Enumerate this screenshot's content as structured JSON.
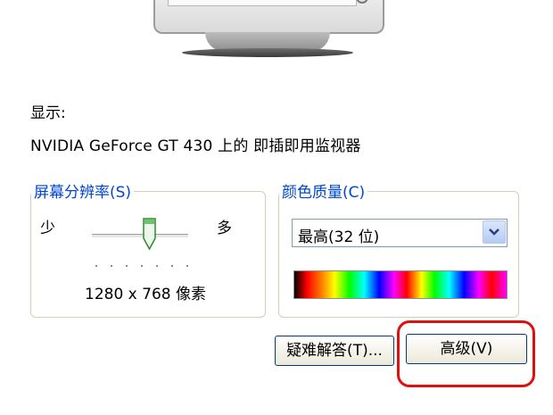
{
  "display": {
    "label": "显示:",
    "device": "NVIDIA GeForce GT 430 上的 即插即用监视器"
  },
  "resolution": {
    "title": "屏幕分辨率(S)",
    "less_label": "少",
    "more_label": "多",
    "value": "1280 x 768 像素",
    "slider_level": 0.6
  },
  "color_quality": {
    "title": "颜色质量(C)",
    "selected": "最高(32 位)"
  },
  "buttons": {
    "troubleshoot": "疑难解答(T)...",
    "advanced": "高级(V)"
  },
  "colors": {
    "group_title": "#0046d5",
    "highlight": "#e01010"
  },
  "icons": {
    "dropdown": "chevron-down-icon",
    "slider": "slider-thumb-icon"
  }
}
